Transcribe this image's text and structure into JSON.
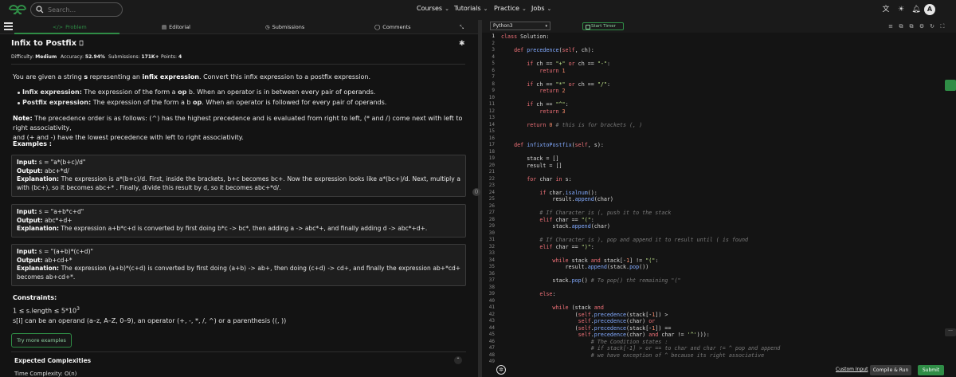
{
  "topbar": {
    "search_placeholder": "Search...",
    "nav": [
      "Courses",
      "Tutorials",
      "Practice",
      "Jobs"
    ],
    "avatar": "A"
  },
  "tabs": {
    "problem": "Problem",
    "editorial": "Editorial",
    "submissions": "Submissions",
    "comments": "Comments"
  },
  "problem": {
    "title": "Infix to Postfix",
    "difficulty_label": "Difficulty:",
    "difficulty": "Medium",
    "accuracy_label": "Accuracy:",
    "accuracy": "52.94%",
    "submissions_label": "Submissions:",
    "submissions": "171K+",
    "points_label": "Points:",
    "points": "4",
    "intro_1": "You are given a string ",
    "intro_s": "s",
    "intro_2": " representing an ",
    "intro_bold": "infix expression",
    "intro_3": ". Convert this infix expression to a postfix expression.",
    "b1_bold": "Infix expression:",
    "b1_text_1": " The expression of the form a ",
    "b1_op": "op",
    "b1_text_2": " b. When an operator is in between every pair of operands.",
    "b2_bold": "Postfix expression:",
    "b2_text_1": " The expression of the form a b ",
    "b2_op": "op",
    "b2_text_2": ". When an operator is followed for every pair of operands.",
    "note_bold": "Note:",
    "note_line1": " The precedence order is as follows: (^) has the highest precedence and is evaluated from right to left, (* and /) come next with left to right associativity,",
    "note_line2": "and (+ and -) have the lowest precedence with left to right associativity.",
    "examples_heading": "Examples :",
    "examples": [
      {
        "input_label": "Input:",
        "input": " s = \"a*(b+c)/d\"",
        "output_label": "Output:",
        "output": " abc+*d/",
        "explanation_label": "Explanation:",
        "explanation": " The expression is a*(b+c)/d. First, inside the brackets, b+c becomes bc+. Now the expression looks like a*(bc+)/d. Next, multiply a with (bc+), so it becomes abc+* . Finally, divide this result by d, so it becomes abc+*d/."
      },
      {
        "input_label": "Input:",
        "input": " s = \"a+b*c+d\"",
        "output_label": "Output:",
        "output": " abc*+d+",
        "explanation_label": "Explanation:",
        "explanation": " The expression a+b*c+d is converted by first doing b*c -> bc*, then adding a -> abc*+, and finally adding d -> abc*+d+."
      },
      {
        "input_label": "Input:",
        "input": " s = \"(a+b)*(c+d)\"",
        "output_label": "Output:",
        "output": " ab+cd+*",
        "explanation_label": "Explanation:",
        "explanation": " The expression (a+b)*(c+d) is converted by first doing (a+b) -> ab+, then doing (c+d) -> cd+, and finally the expression ab+*cd+ becomes ab+cd+*."
      }
    ],
    "constraints_heading": "Constraints:",
    "constraint_1": "1 ≤ s.length ≤ 5*10",
    "constraint_1_sup": "3",
    "constraint_2": "s[i] can be an operand (a–z, A–Z, 0–9), an operator (+, -, *, /, ^) or a parenthesis ((, ))",
    "try_more": "Try more examples",
    "expected_heading": "Expected Complexities",
    "time_complexity": "Time Complexity: O(n)"
  },
  "editor": {
    "language": "Python3",
    "start_timer": "Start Timer",
    "custom_input": "Custom Input",
    "compile_run": "Compile & Run",
    "submit": "Submit",
    "line_numbers": [
      "1",
      "2",
      "3",
      "4",
      "5",
      "6",
      "7",
      "8",
      "9",
      "10",
      "11",
      "12",
      "13",
      "14",
      "15",
      "16",
      "17",
      "18",
      "19",
      "20",
      "21",
      "22",
      "23",
      "24",
      "25",
      "26",
      "27",
      "28",
      "29",
      "30",
      "31",
      "32",
      "33",
      "34",
      "35",
      "36",
      "37",
      "38",
      "39",
      "40",
      "41",
      "42",
      "43",
      "44",
      "45",
      "46",
      "47",
      "48",
      "49"
    ],
    "code_lines": [
      "class Solution:",
      "",
      "    def precedence(self, ch):",
      "",
      "        if ch == \"+\" or ch == \"-\":",
      "            return 1",
      "",
      "        if ch == \"*\" or ch == \"/\":",
      "            return 2",
      "",
      "        if ch == \"^\":",
      "            return 3",
      "",
      "        return 0 # this is for brackets (, )",
      "",
      "",
      "    def infixtoPostfix(self, s):",
      "",
      "        stack = []",
      "        result = []",
      "",
      "        for char in s:",
      "",
      "            if char.isalnum():",
      "                result.append(char)",
      "",
      "            # If Character is (, push it to the stack",
      "            elif char == \"(\":",
      "                stack.append(char)",
      "",
      "            # If Character is ), pop and append it to result until ( is found",
      "            elif char == \")\":",
      "",
      "                while stack and stack[-1] != \"(\":",
      "                    result.append(stack.pop())",
      "",
      "                stack.pop() # To pop() tht remaining \"(\"",
      "",
      "            else:",
      "",
      "                while (stack and",
      "                       (self.precedence(stack[-1]) >",
      "                        self.precedence(char) or",
      "                       (self.precedence(stack[-1]) ==",
      "                        self.precedence(char) and char != '^'))):",
      "                            # The Condition states :",
      "                            # if stack[-1] > or == to char and char != ^ pop and append",
      "                            # we have exception of ^ because its right associative",
      ""
    ]
  },
  "colors": {
    "accent_green": "#2f8d46",
    "background": "#131313"
  }
}
